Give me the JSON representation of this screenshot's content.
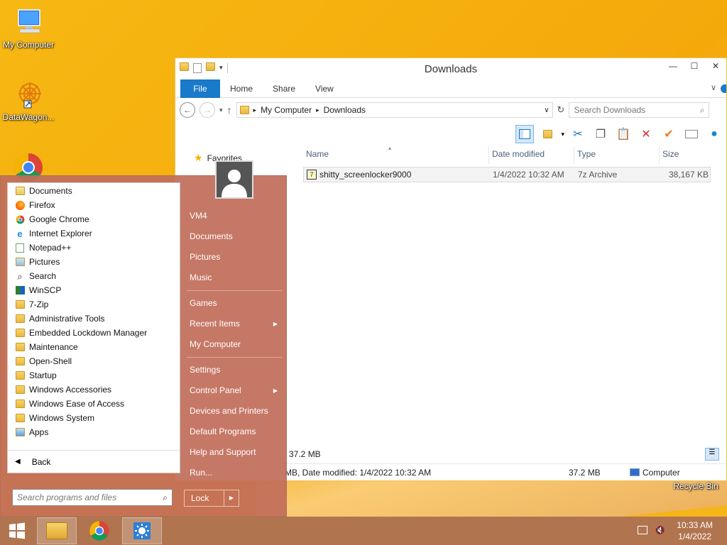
{
  "desktop": {
    "icons": [
      {
        "label": "My Computer"
      },
      {
        "label": "DataWagon..."
      },
      {
        "label": "Recycle Bin"
      }
    ]
  },
  "explorer": {
    "title": "Downloads",
    "tabs": [
      "File",
      "Home",
      "Share",
      "View"
    ],
    "breadcrumb": [
      "My Computer",
      "Downloads"
    ],
    "search_placeholder": "Search Downloads",
    "nav_favorites": "Favorites",
    "columns": [
      "Name",
      "Date modified",
      "Type",
      "Size"
    ],
    "files": [
      {
        "name": "shitty_screenlocker9000",
        "date": "1/4/2022 10:32 AM",
        "type": "7z Archive",
        "size": "38,167 KB"
      }
    ],
    "status_size": "37.2 MB",
    "details_text": "MB, Date modified: 1/4/2022 10:32 AM",
    "details_size": "37.2 MB",
    "details_location": "Computer"
  },
  "startmenu": {
    "programs": [
      {
        "label": "Documents",
        "icon": "folder-docs-icon"
      },
      {
        "label": "Firefox",
        "icon": "firefox-icon"
      },
      {
        "label": "Google Chrome",
        "icon": "chrome-icon"
      },
      {
        "label": "Internet Explorer",
        "icon": "ie-icon"
      },
      {
        "label": "Notepad++",
        "icon": "notepadpp-icon"
      },
      {
        "label": "Pictures",
        "icon": "folder-pictures-icon"
      },
      {
        "label": "Search",
        "icon": "search-icon"
      },
      {
        "label": "WinSCP",
        "icon": "winscp-icon"
      },
      {
        "label": "7-Zip",
        "icon": "folder-icon"
      },
      {
        "label": "Administrative Tools",
        "icon": "folder-icon"
      },
      {
        "label": "Embedded Lockdown Manager",
        "icon": "folder-icon"
      },
      {
        "label": "Maintenance",
        "icon": "folder-icon"
      },
      {
        "label": "Open-Shell",
        "icon": "folder-icon"
      },
      {
        "label": "Startup",
        "icon": "folder-icon"
      },
      {
        "label": "Windows Accessories",
        "icon": "folder-icon"
      },
      {
        "label": "Windows Ease of Access",
        "icon": "folder-icon"
      },
      {
        "label": "Windows System",
        "icon": "folder-icon"
      },
      {
        "label": "Apps",
        "icon": "folder-apps-icon"
      }
    ],
    "back_label": "Back",
    "search_placeholder": "Search programs and files",
    "right_items": [
      {
        "label": "VM4",
        "arrow": false
      },
      {
        "label": "Documents",
        "arrow": false
      },
      {
        "label": "Pictures",
        "arrow": false
      },
      {
        "label": "Music",
        "arrow": false
      },
      {
        "label": "Games",
        "arrow": false
      },
      {
        "label": "Recent Items",
        "arrow": true
      },
      {
        "label": "My Computer",
        "arrow": false
      },
      {
        "label": "Settings",
        "arrow": false
      },
      {
        "label": "Control Panel",
        "arrow": true
      },
      {
        "label": "Devices and Printers",
        "arrow": false
      },
      {
        "label": "Default Programs",
        "arrow": false
      },
      {
        "label": "Help and Support",
        "arrow": false
      },
      {
        "label": "Run...",
        "arrow": false
      }
    ],
    "lock_label": "Lock"
  },
  "taskbar": {
    "time": "10:33 AM",
    "date": "1/4/2022"
  },
  "colors": {
    "accent": "#1979ca",
    "startmenu_bg": "#c26e5a",
    "taskbar_bg": "#b0754f"
  }
}
